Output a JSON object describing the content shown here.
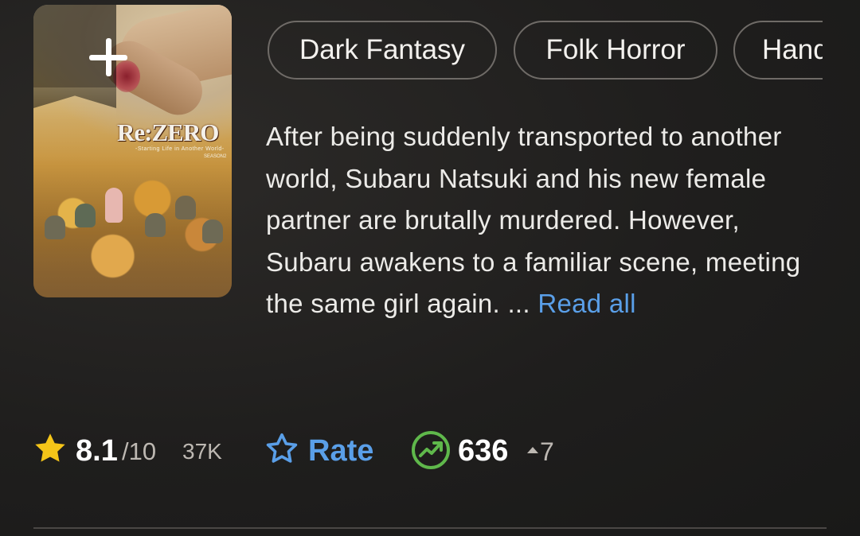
{
  "poster": {
    "logo_title": "Re:ZERO",
    "logo_subtitle": "-Starting Life in Another World-",
    "logo_season": "SEASON2",
    "add_icon": "plus-icon"
  },
  "genres": [
    "Dark Fantasy",
    "Folk Horror",
    "Hand"
  ],
  "plot": {
    "text": "After being suddenly transported to another world, Subaru Natsuki and his new female partner are brutally murdered. However, Subaru awakens to a familiar scene, meeting the same girl again. ...",
    "read_all": "Read all"
  },
  "rating": {
    "score": "8.1",
    "out_of": "/10",
    "votes": "37K",
    "star_icon": "star-icon",
    "star_color": "#f5c518"
  },
  "rate_button": {
    "label": "Rate",
    "icon": "star-outline-icon",
    "color": "#5a9fe8"
  },
  "popularity": {
    "rank": "636",
    "change": "7",
    "icon": "trending-up-icon",
    "icon_color": "#5fb84b"
  }
}
